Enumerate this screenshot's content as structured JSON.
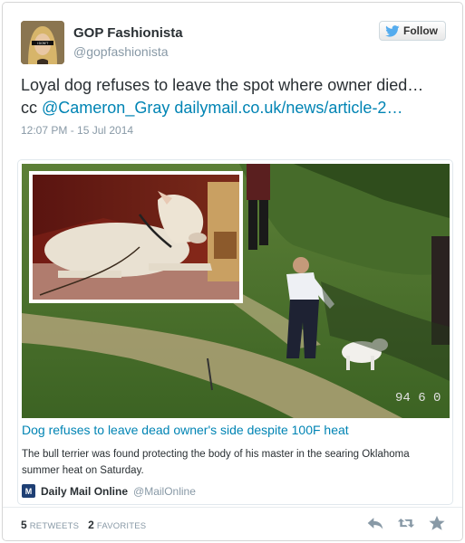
{
  "user": {
    "name": "GOP Fashionista",
    "handle": "@gopfashionista",
    "avatar_badge": "I DON'T"
  },
  "follow": {
    "label": "Follow"
  },
  "tweet": {
    "text_line1": "Loyal dog refuses to leave the spot where owner died…",
    "cc_prefix": "cc ",
    "mention": "@Cameron_Gray",
    "link": "dailymail.co.uk/news/article-2…",
    "timestamp": "12:07 PM - 15 Jul 2014"
  },
  "card": {
    "overlay_text": "94 6 0",
    "title": "Dog refuses to leave dead owner's side despite 100F heat",
    "description": "The bull terrier was found protecting the body of his master in the searing Oklahoma summer heat on Saturday.",
    "source_name": "Daily Mail Online",
    "source_handle": "@MailOnline",
    "source_logo": "M"
  },
  "stats": {
    "retweets_count": "5",
    "retweets_label": "Retweets",
    "favorites_count": "2",
    "favorites_label": "Favorites"
  },
  "icons": [
    "twitter-bird-icon",
    "reply-icon",
    "retweet-icon",
    "favorite-star-icon"
  ],
  "colors": {
    "link": "#0084b4",
    "muted": "#8899a6",
    "twitter_blue": "#55acee"
  }
}
